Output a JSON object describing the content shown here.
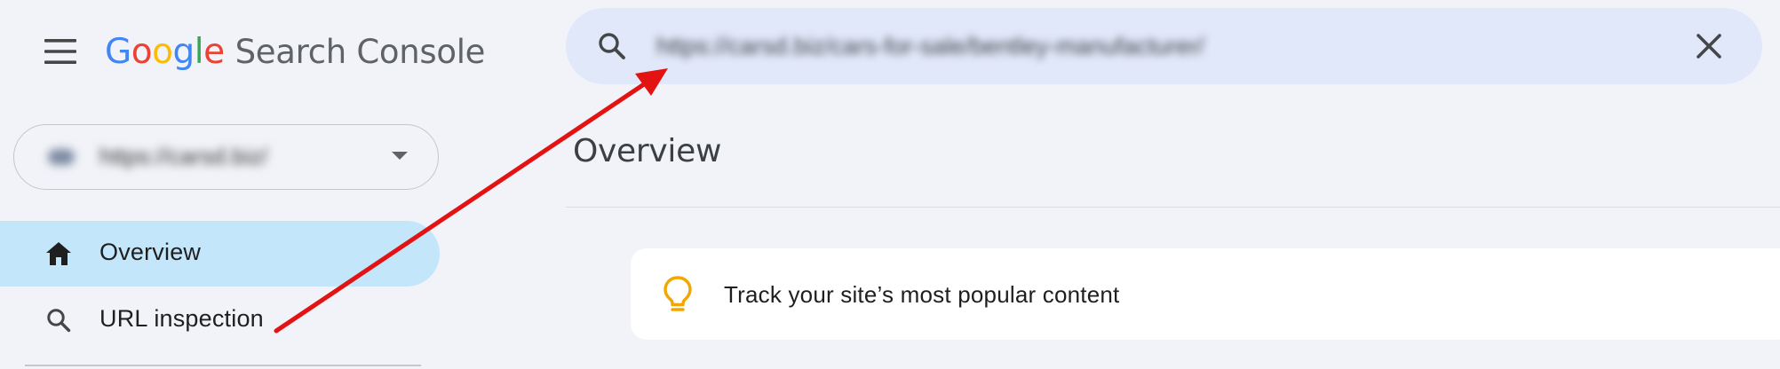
{
  "app": {
    "logo_letters": [
      "G",
      "o",
      "o",
      "g",
      "l",
      "e"
    ],
    "logo_colors": [
      "#4285f4",
      "#ea4335",
      "#fbbc05",
      "#4285f4",
      "#34a853",
      "#ea4335"
    ],
    "product_name": "Search Console"
  },
  "header": {
    "menu_icon": "hamburger-menu-icon",
    "search": {
      "icon": "search-icon",
      "value": "https://carsd.biz/cars-for-sale/bentley-manufacturer/",
      "clear_icon": "close-icon"
    }
  },
  "sidebar": {
    "property": {
      "name": "https://carsd.biz/",
      "dropdown_icon": "caret-down-icon"
    },
    "items": [
      {
        "label": "Overview",
        "icon": "home-icon",
        "active": true
      },
      {
        "label": "URL inspection",
        "icon": "search-icon",
        "active": false
      }
    ]
  },
  "main": {
    "title": "Overview",
    "tip": {
      "icon": "lightbulb-icon",
      "text": "Track your site’s most popular content"
    }
  },
  "colors": {
    "background": "#f1f3f8",
    "search_bar": "#e1e8fa",
    "nav_active": "#c3e6fb",
    "card": "#ffffff",
    "bulb": "#f2a600",
    "annotation_arrow": "#e31313"
  }
}
